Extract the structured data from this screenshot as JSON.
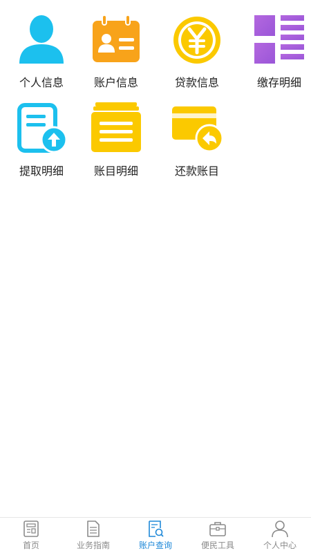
{
  "menu": {
    "items": [
      {
        "label": "个人信息",
        "icon": "person-icon"
      },
      {
        "label": "账户信息",
        "icon": "id-card-icon"
      },
      {
        "label": "贷款信息",
        "icon": "yen-coin-icon"
      },
      {
        "label": "缴存明细",
        "icon": "grid-list-icon"
      },
      {
        "label": "提取明细",
        "icon": "document-upload-icon"
      },
      {
        "label": "账目明细",
        "icon": "ledger-icon"
      },
      {
        "label": "还款账目",
        "icon": "card-return-icon"
      }
    ]
  },
  "tabbar": {
    "items": [
      {
        "label": "首页",
        "icon": "newspaper-icon"
      },
      {
        "label": "业务指南",
        "icon": "document-icon"
      },
      {
        "label": "账户查询",
        "icon": "search-document-icon",
        "active": true
      },
      {
        "label": "便民工具",
        "icon": "briefcase-icon"
      },
      {
        "label": "个人中心",
        "icon": "user-icon"
      }
    ]
  },
  "colors": {
    "cyan": "#1cc0ee",
    "orange": "#f8a31a",
    "yellow": "#fbc900",
    "purple": "#a45fdb",
    "active_tab": "#1e88d8",
    "inactive_tab": "#8a8a8a"
  }
}
